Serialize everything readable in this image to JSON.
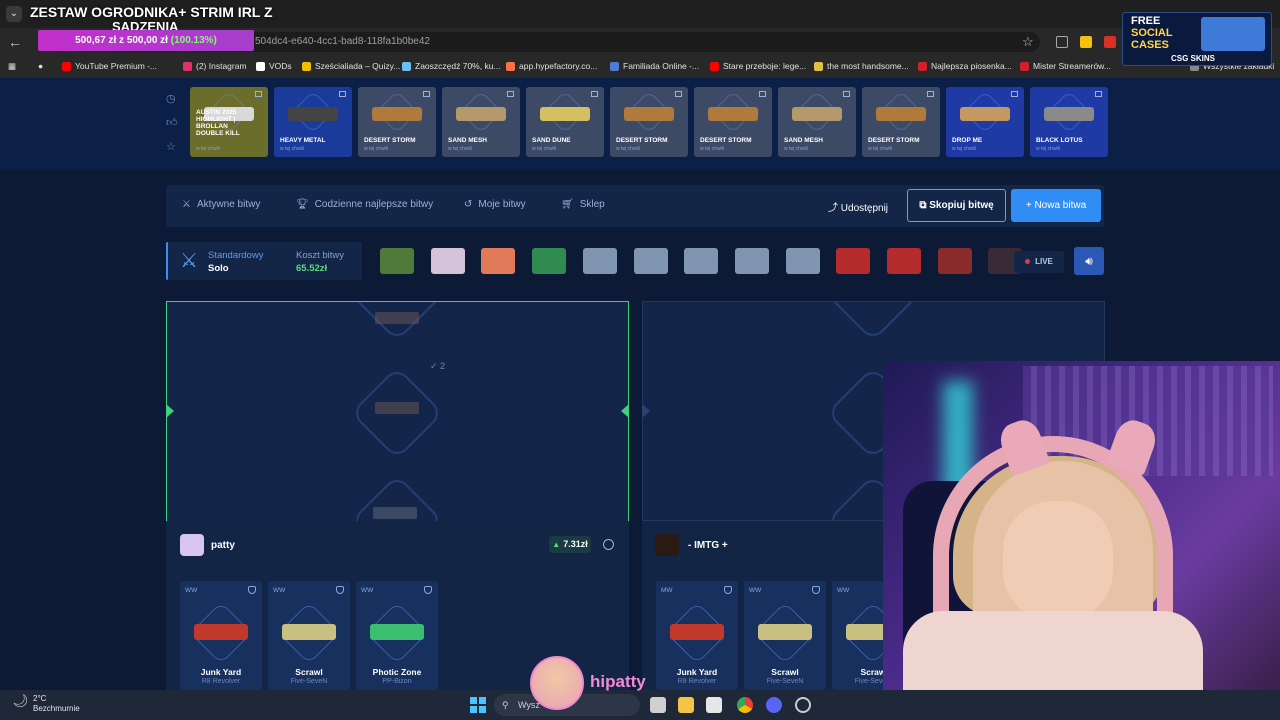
{
  "overlay": {
    "title": "ZESTAW OGRODNIKA+ STRIM IRL Z",
    "subtitle": "SADZENIA",
    "goal_current": "500,67 zł",
    "goal_connector": "z",
    "goal_target": "500,00 zł",
    "goal_percent": "(100.13%)",
    "promo_line1": "FREE",
    "promo_line2": "SOCIAL",
    "promo_line3": "CASES",
    "promo_brand": "CSG SKINS",
    "streamer": "hipatty"
  },
  "browser": {
    "url_fragment": "504dc4-e640-4cc1-bad8-118fa1b0be42",
    "bookmarks": [
      {
        "label": "YouTube Premium -...",
        "color": "#ff0000"
      },
      {
        "label": "(2) Instagram",
        "color": "#e1306c"
      },
      {
        "label": "VODs",
        "color": "#ffffff"
      },
      {
        "label": "Sześcialiada – Quizy...",
        "color": "#f0c000"
      },
      {
        "label": "Zaoszczędź 70%, ku...",
        "color": "#66c0f4"
      },
      {
        "label": "app.hypefactory.co...",
        "color": "#ff7043"
      },
      {
        "label": "Familiada Online -...",
        "color": "#4e7bd6"
      },
      {
        "label": "Stare przeboje: lege...",
        "color": "#ff0000"
      },
      {
        "label": "the most handsome...",
        "color": "#e0c040"
      },
      {
        "label": "Najlepsza piosenka...",
        "color": "#d0202c"
      },
      {
        "label": "Mister Streamerów...",
        "color": "#d0202c"
      },
      {
        "label": "Wszystkie zakładki",
        "color": "#888888"
      }
    ]
  },
  "feed": {
    "drops": [
      {
        "name": "AUSTIN 2025 HIGHLIGHT | BROLLAN DOUBLE KILL",
        "sub": "w tej chwili",
        "bg": "#6b6d2a",
        "gun": "#d9d9d9"
      },
      {
        "name": "HEAVY METAL",
        "sub": "w tej chwili",
        "bg": "#1a3b9a",
        "gun": "#444444"
      },
      {
        "name": "DESERT STORM",
        "sub": "w tej chwili",
        "bg": "#3c4a66",
        "gun": "#b07a3c"
      },
      {
        "name": "SAND MESH",
        "sub": "w tej chwili",
        "bg": "#3c4a66",
        "gun": "#b49a6a"
      },
      {
        "name": "SAND DUNE",
        "sub": "w tej chwili",
        "bg": "#3c4a66",
        "gun": "#d4c060"
      },
      {
        "name": "DESERT STORM",
        "sub": "w tej chwili",
        "bg": "#3c4a66",
        "gun": "#b07a3c"
      },
      {
        "name": "DESERT STORM",
        "sub": "w tej chwili",
        "bg": "#3c4a66",
        "gun": "#b07a3c"
      },
      {
        "name": "SAND MESH",
        "sub": "w tej chwili",
        "bg": "#3c4a66",
        "gun": "#b49a6a"
      },
      {
        "name": "DESERT STORM",
        "sub": "w tej chwili",
        "bg": "#3c4a66",
        "gun": "#b07a3c"
      },
      {
        "name": "DROP ME",
        "sub": "w tej chwili",
        "bg": "#1f3aa5",
        "gun": "#c49860"
      },
      {
        "name": "BLACK LOTUS",
        "sub": "w tej chwili",
        "bg": "#1f3aa5",
        "gun": "#8a8a8a"
      }
    ]
  },
  "nav": {
    "active_battles": "Aktywne bitwy",
    "daily_best": "Codzienne najlepsze bitwy",
    "my_battles": "Moje bitwy",
    "shop": "Sklep",
    "share": "Udostępnij",
    "copy_battle": "Skopiuj bitwę",
    "new_battle": "Nowa bitwa"
  },
  "battle": {
    "mode_label": "Standardowy",
    "mode_value": "Solo",
    "cost_label": "Koszt bitwy",
    "cost_value": "65.52zł",
    "live": "LIVE",
    "round_marker": "2",
    "cases": [
      {
        "color": "#4f7a3a"
      },
      {
        "color": "#d4c2d8"
      },
      {
        "color": "#e07a58"
      },
      {
        "color": "#2f8b4f"
      },
      {
        "color": "#7f95b0"
      },
      {
        "color": "#7f95b0"
      },
      {
        "color": "#7f95b0"
      },
      {
        "color": "#7f95b0"
      },
      {
        "color": "#7f95b0"
      },
      {
        "color": "#b52a2a"
      },
      {
        "color": "#b52a2a"
      },
      {
        "color": "#8a2a2a"
      },
      {
        "color": "#3a2a35"
      }
    ]
  },
  "players": [
    {
      "name": "patty",
      "value": "7.31zł",
      "items": [
        {
          "wear": "WW",
          "name": "Junk Yard",
          "type": "R8 Revolver",
          "gun": "#c0392b"
        },
        {
          "wear": "WW",
          "name": "Scrawl",
          "type": "Five-SeveN",
          "gun": "#c8c080"
        },
        {
          "wear": "WW",
          "name": "Photic Zone",
          "type": "PP-Bizon",
          "gun": "#3bbf6e"
        }
      ]
    },
    {
      "name": "- IMTG +",
      "items": [
        {
          "wear": "MW",
          "name": "Junk Yard",
          "type": "R8 Revolver",
          "gun": "#c0392b"
        },
        {
          "wear": "WW",
          "name": "Scrawl",
          "type": "Five-SeveN",
          "gun": "#c8c080"
        },
        {
          "wear": "WW",
          "name": "Scraw",
          "type": "Five-SeveN",
          "gun": "#c8c080"
        }
      ]
    }
  ],
  "taskbar": {
    "temp": "2°C",
    "weather": "Bezchmurnie",
    "search": "Wysz"
  }
}
